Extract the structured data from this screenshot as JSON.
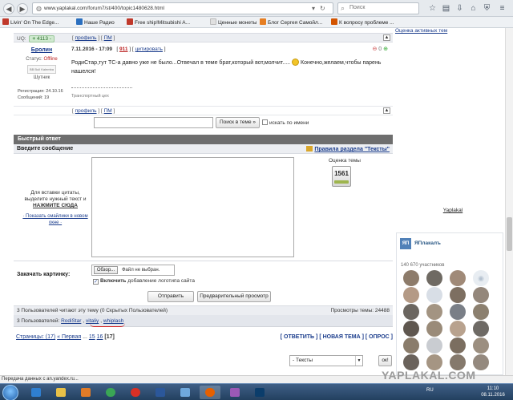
{
  "browser": {
    "url": "www.yaplakal.com/forum7/st/400/topic1480628.html",
    "search_placeholder": "Поиск",
    "bookmarks": [
      {
        "label": "Livin' On The Edge...",
        "color": "#444444"
      },
      {
        "label": "Наше Радио",
        "color": "#2a6fbf"
      },
      {
        "label": "Free ship!Mitsubishi A...",
        "color": "#c0392b"
      },
      {
        "label": "Ценные монеты",
        "color": "#e0e0e0"
      },
      {
        "label": "Блог Сергея Самойл...",
        "color": "#e67e22"
      },
      {
        "label": "К вопросу проблеме ...",
        "color": "#d35400"
      }
    ],
    "status_text": "Передача данных с an.yandex.ru..."
  },
  "top_bar": {
    "uq_label": "UQ:",
    "rep_value": "4113",
    "profile_label": "профиль",
    "pm_label": "ПМ",
    "right_link": "Оценка активных тем"
  },
  "post": {
    "author": "Бролин",
    "status_label": "Статус:",
    "status_value": "Offline",
    "avatar_text": "BB Bull Kalemba",
    "rank": "Шутник",
    "reg_label": "Регистрация:",
    "reg_date": "24.10.16",
    "msgs_label": "Сообщений:",
    "msgs_count": "19",
    "date": "7.11.2016 - 17:09",
    "post_num": "911",
    "quote_label": "цитировать",
    "vote_count": "0",
    "text_line1": "РодиСтар,тут ТС-а давно уже не было...Отвечал в теме брат,который вот,молчит.....",
    "text_line2": "Конечно,желаем,чтобы парень нашелся!",
    "signature": "Транспортный цех",
    "profile_label": "профиль",
    "pm_label": "ПМ"
  },
  "search": {
    "button": "Поиск в теме »",
    "anon_label": "искать по имени"
  },
  "quick_reply": {
    "title": "Быстрый ответ",
    "enter_label": "Введите сообщение",
    "rules_link": "Правила раздела \"Тексты\"",
    "hint_line1": "Для вставки цитаты,",
    "hint_line2": "выделите нужный текст и",
    "hint_strong": "НАЖМИТЕ СЮДА",
    "hint_smileys": "· Показать смайлики в новом окне ·",
    "rating_title": "Оценка темы",
    "rating_value": "1561",
    "upload_label": "Закачать картинку:",
    "browse_button": "Обзор...",
    "file_status": "Файл не выбран.",
    "logo_bold": "Включить",
    "logo_rest": "добавление логотипа сайта",
    "send_button": "Отправить",
    "preview_button": "Предварительный просмотр"
  },
  "readers": {
    "header": "3 Пользователей читают эту тему (0 Скрытых Пользователей)",
    "views": "Просмотры темы: 24488",
    "prefix": "3 Пользователей:",
    "users": [
      "RodiStar",
      "vitaliy",
      "whiplash"
    ]
  },
  "pagination": {
    "prefix": "Страницы: (17)",
    "first": "« Первая",
    "ellipsis": "...",
    "pages": [
      "15",
      "16"
    ],
    "current": "[17]",
    "reply": "[ ОТВЕТИТЬ ]",
    "new_topic": "[ НОВАЯ ТЕМА ]",
    "poll": "[ ОПРОС ]"
  },
  "jump": {
    "selected": "- Тексты",
    "ok": "ок!"
  },
  "vk_widget": {
    "caption": "Yaplakal",
    "name": "ЯПлакалъ",
    "members": "140 670 участников"
  },
  "watermark": "YAPLAKAL.COM",
  "taskbar": {
    "lang": "RU",
    "time": "11:10",
    "date": "08.11.2016"
  }
}
